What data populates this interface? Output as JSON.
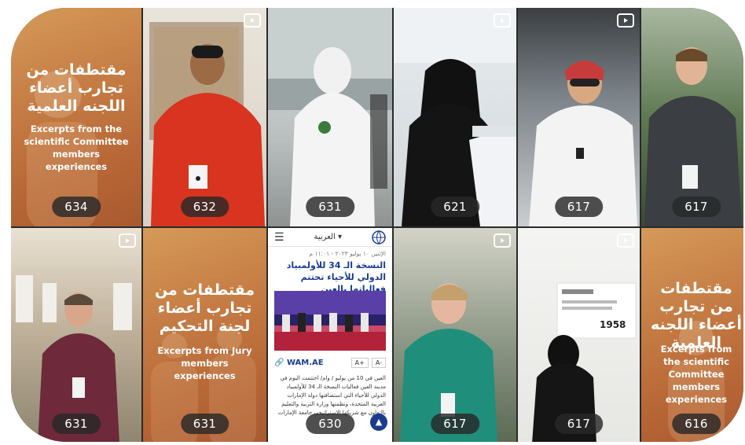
{
  "tiles": [
    {
      "count": "634",
      "title_ar": "مقتطفات من تجارب أعضاء اللجنه العلمية",
      "title_en": "Excerpts from the scientific Committee members experiences"
    },
    {
      "count": "632"
    },
    {
      "count": "631"
    },
    {
      "count": "621"
    },
    {
      "count": "617"
    },
    {
      "count": "617"
    },
    {
      "count": "631"
    },
    {
      "count": "631",
      "title_ar": "مقتطفات من تجارب أعضاء لجنة التحكيم",
      "title_en": "Excerpts from Jury members experiences"
    },
    {
      "count": "630",
      "lang": "العربية",
      "date": "الإثنين ١٠ يوليو ٢٠٢٣ - ١١:٠١ م",
      "headline": "النسخة الـ 34 للأولمبياد الدولي للأحياء تحتتم فعالياتها بالعين",
      "brand": "WAM.AE",
      "font_plus": "A+",
      "font_minus": "A-",
      "body": "العين في 10 من يوليو / وام/ اختتمت اليوم في مدينة العين فعاليات النسخة الـ 34 للأولمبياد الدولي للأحياء التي استضافتها دولة الإمارات العربية المتحدة، ونظمتها وزارة التربية والتعليم بالتعاون مع شريكها الاستراتيجي جامعة الإمارات"
    },
    {
      "count": "617"
    },
    {
      "count": "617",
      "poster_year": "1958"
    },
    {
      "count": "616",
      "title_ar": "مقتطفات من تجارب أعضاء اللجنه العلمية",
      "title_en": "Excerpts from the scientific Committee members experiences"
    }
  ],
  "colors": {
    "warm": "#c57c44",
    "badge_bg": "#282828",
    "link": "#1a3c8f"
  },
  "icons": {
    "reel": "reel-video-icon",
    "menu": "hamburger-menu-icon",
    "chevron": "chevron-down-icon",
    "link": "link-icon",
    "up": "arrow-up-icon",
    "globe": "globe-logo-icon"
  }
}
